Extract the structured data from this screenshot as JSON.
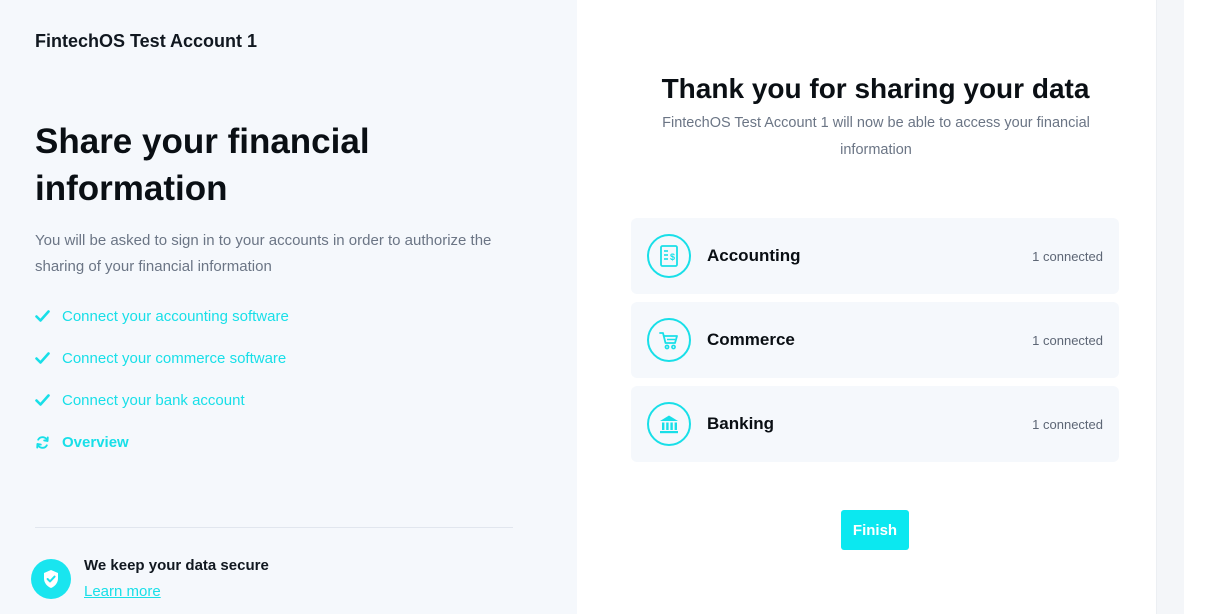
{
  "left": {
    "org_name": "FintechOS Test Account 1",
    "heading": "Share your financial information",
    "intro": "You will be asked to sign in to your accounts in order to authorize the sharing of your financial information",
    "steps": [
      {
        "label": "Connect your accounting software",
        "state": "done",
        "icon": "check-icon"
      },
      {
        "label": "Connect your commerce software",
        "state": "done",
        "icon": "check-icon"
      },
      {
        "label": "Connect your bank account",
        "state": "done",
        "icon": "check-icon"
      },
      {
        "label": "Overview",
        "state": "current",
        "icon": "refresh-icon"
      }
    ],
    "security": {
      "title": "We keep your data secure",
      "link": "Learn more",
      "icon": "shield-check-icon"
    }
  },
  "right": {
    "title": "Thank you for sharing your data",
    "subtitle": "FintechOS Test Account 1 will now be able to access your financial information",
    "cards": [
      {
        "name": "Accounting",
        "status": "1 connected",
        "icon": "invoice-dollar-icon"
      },
      {
        "name": "Commerce",
        "status": "1 connected",
        "icon": "shopping-cart-icon"
      },
      {
        "name": "Banking",
        "status": "1 connected",
        "icon": "bank-icon"
      }
    ],
    "finish_label": "Finish"
  },
  "colors": {
    "accent": "#18dfe8",
    "button": "#0be8f0",
    "left_bg": "#f5f8fc",
    "card_bg": "#f5f8fc",
    "heading_text": "#0a0f14",
    "muted_text": "#6b7585"
  }
}
